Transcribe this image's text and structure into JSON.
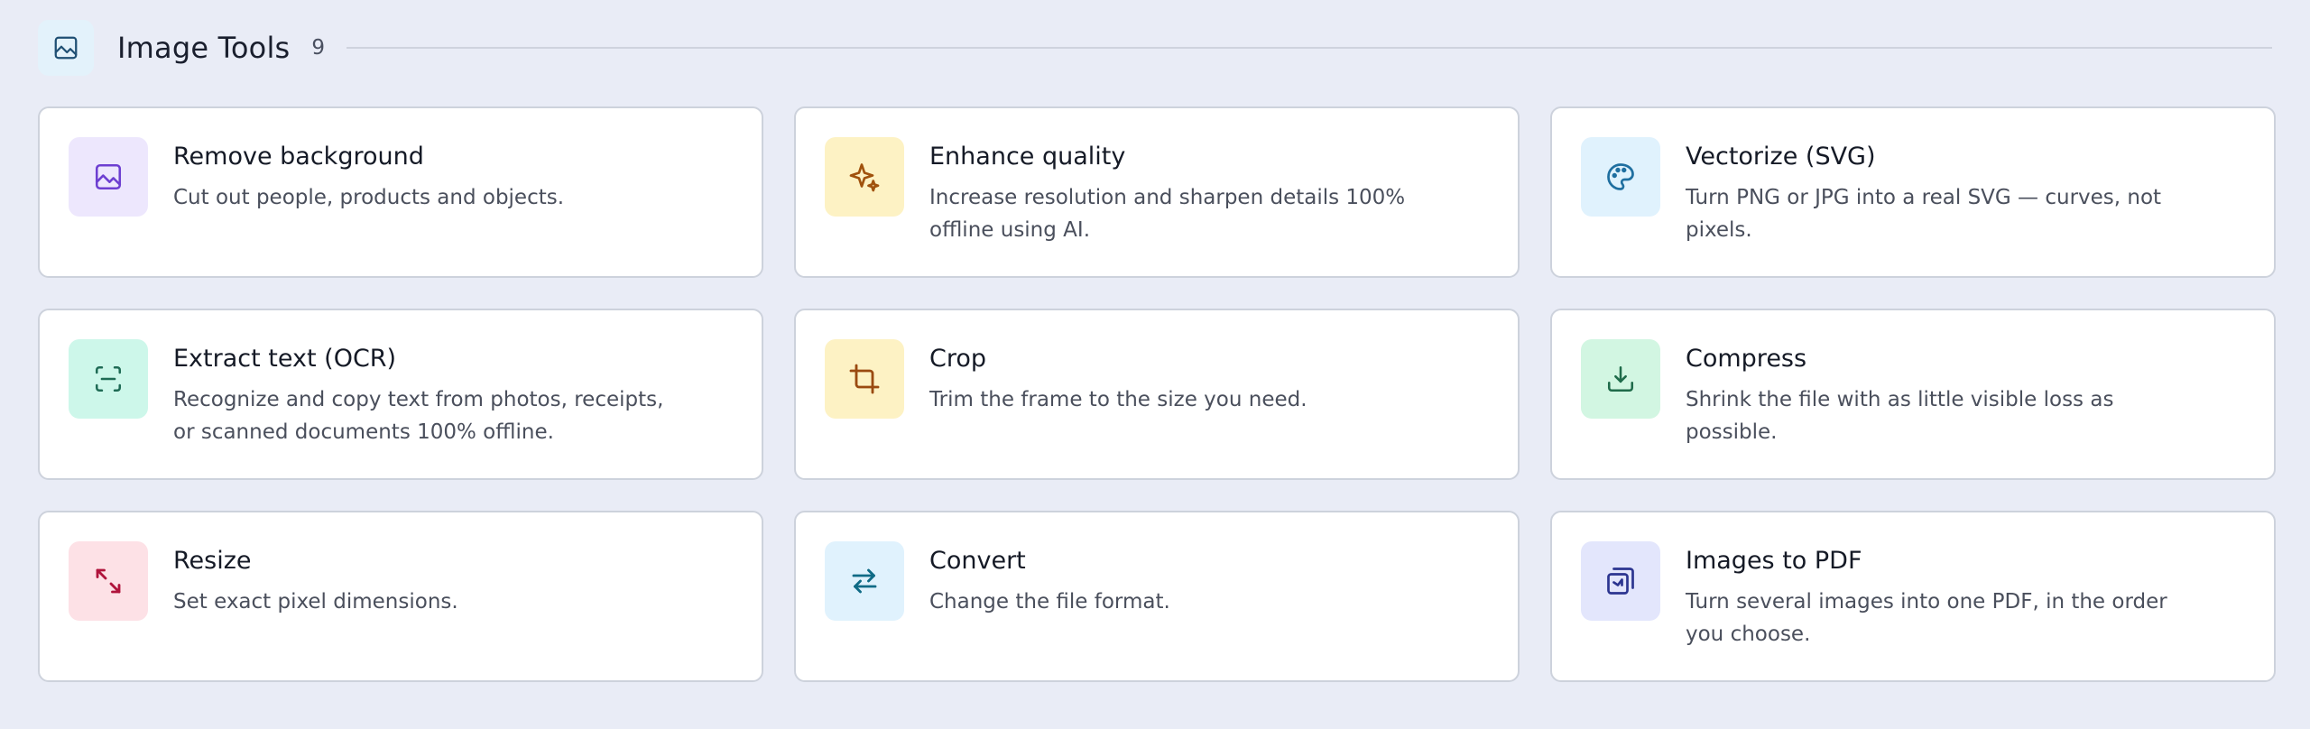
{
  "section": {
    "title": "Image Tools",
    "count": "9",
    "icon": "image-icon"
  },
  "colors": {
    "background": "#e9ecf6",
    "card": "#ffffff",
    "border": "#cdd2dc"
  },
  "tools": [
    {
      "title": "Remove background",
      "description": "Cut out people, products and objects.",
      "icon": "image-icon",
      "icon_bg": "#ede7fd",
      "icon_color": "#6d3fd1"
    },
    {
      "title": "Enhance quality",
      "description": "Increase resolution and sharpen details 100% offline using AI.",
      "icon": "sparkles-icon",
      "icon_bg": "#fdf2c4",
      "icon_color": "#a0520d"
    },
    {
      "title": "Vectorize (SVG)",
      "description": "Turn PNG or JPG into a real SVG — curves, not pixels.",
      "icon": "palette-icon",
      "icon_bg": "#e0f2fd",
      "icon_color": "#1f6fa0"
    },
    {
      "title": "Extract text (OCR)",
      "description": "Recognize and copy text from photos, receipts, or scanned documents 100% offline.",
      "icon": "scan-text-icon",
      "icon_bg": "#cdf7ea",
      "icon_color": "#1f6b55"
    },
    {
      "title": "Crop",
      "description": "Trim the frame to the size you need.",
      "icon": "crop-icon",
      "icon_bg": "#fdf2c4",
      "icon_color": "#9a4a10"
    },
    {
      "title": "Compress",
      "description": "Shrink the file with as little visible loss as possible.",
      "icon": "download-icon",
      "icon_bg": "#d2f6e2",
      "icon_color": "#1f6b4a"
    },
    {
      "title": "Resize",
      "description": "Set exact pixel dimensions.",
      "icon": "resize-arrows-icon",
      "icon_bg": "#fde1e6",
      "icon_color": "#b0143c"
    },
    {
      "title": "Convert",
      "description": "Change the file format.",
      "icon": "swap-arrows-icon",
      "icon_bg": "#e0f2fd",
      "icon_color": "#0f6b86"
    },
    {
      "title": "Images to PDF",
      "description": "Turn several images into one PDF, in the order you choose.",
      "icon": "copy-image-icon",
      "icon_bg": "#e3e6fc",
      "icon_color": "#2c3590"
    }
  ]
}
